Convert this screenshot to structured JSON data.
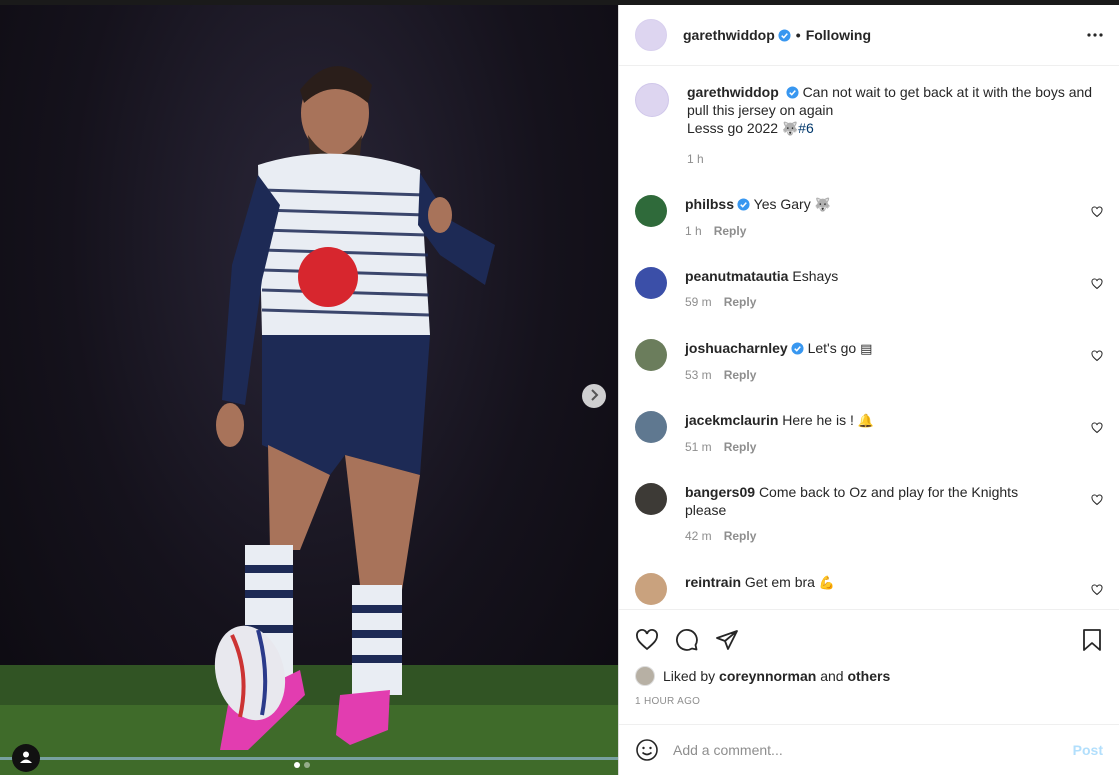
{
  "post": {
    "author": "garethwiddop",
    "follow_state": "Following",
    "bullet": "•",
    "caption_line1": "Can not wait to get back at it with the boys and pull this jersey on again",
    "caption_line2": "Lesss go 2022",
    "caption_emoji": "🐺",
    "hashtag": "#6",
    "caption_time": "1 h"
  },
  "comments": [
    {
      "user": "philbss",
      "verified": true,
      "text": "Yes Gary",
      "emoji": "🐺",
      "time": "1 h",
      "reply": "Reply",
      "avatar_color": "#2f6a3a"
    },
    {
      "user": "peanutmatautia",
      "verified": false,
      "text": "Eshays",
      "emoji": "",
      "time": "59 m",
      "reply": "Reply",
      "avatar_color": "#3b4fa8"
    },
    {
      "user": "joshuacharnley",
      "verified": true,
      "text": "Let's go",
      "emoji": "▤",
      "time": "53 m",
      "reply": "Reply",
      "avatar_color": "#6b7d5c"
    },
    {
      "user": "jacekmclaurin",
      "verified": false,
      "text": "Here he is !",
      "emoji": "🔔",
      "time": "51 m",
      "reply": "Reply",
      "avatar_color": "#5f7890"
    },
    {
      "user": "bangers09",
      "verified": false,
      "text": "Come back to Oz and play for the Knights please",
      "emoji": "",
      "time": "42 m",
      "reply": "Reply",
      "avatar_color": "#3d3a36"
    },
    {
      "user": "reintrain",
      "verified": false,
      "text": "Get em bra",
      "emoji": "💪",
      "time": "",
      "reply": "",
      "avatar_color": "#c9a27e"
    }
  ],
  "likes": {
    "prefix": "Liked by",
    "user": "coreynnorman",
    "and": "and",
    "others": "others",
    "time_ago": "1 HOUR AGO"
  },
  "composer": {
    "placeholder": "Add a comment...",
    "post_label": "Post"
  },
  "colors": {
    "verified": "#3897f0",
    "link": "#00376b",
    "post_disabled": "#b2dffc",
    "muted": "#8e8e8e"
  },
  "icons": [
    "more-horizontal-icon",
    "heart-icon",
    "comment-icon",
    "share-icon",
    "bookmark-icon",
    "emoji-icon",
    "chevron-right-icon",
    "user-tag-icon"
  ]
}
